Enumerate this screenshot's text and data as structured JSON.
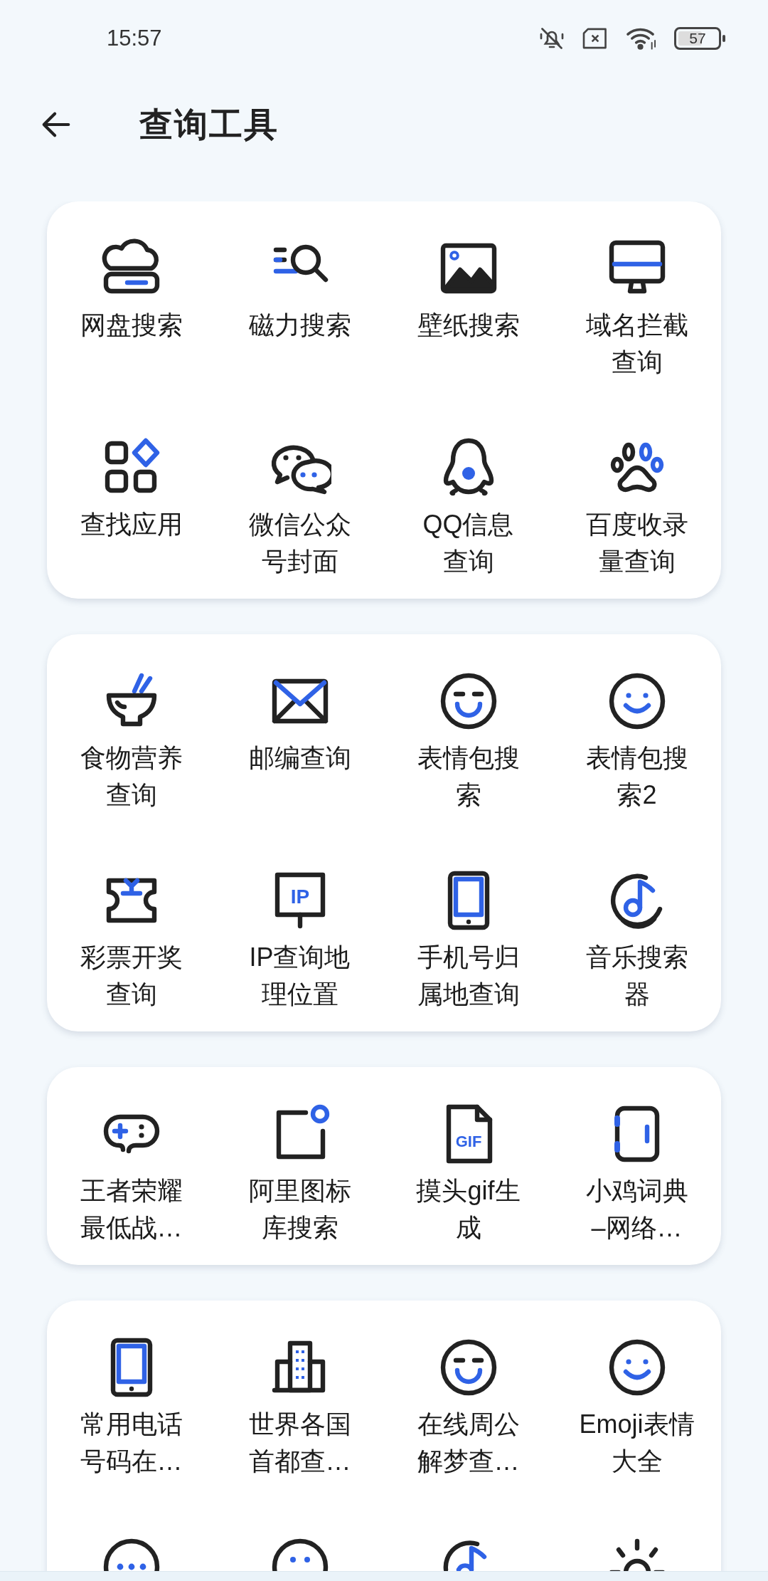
{
  "status_bar": {
    "time": "15:57",
    "battery": "57"
  },
  "header": {
    "title": "查询工具"
  },
  "cards": [
    {
      "items": [
        {
          "label": "网盘搜索"
        },
        {
          "label": "磁力搜索"
        },
        {
          "label": "壁纸搜索"
        },
        {
          "label": "域名拦截查询"
        },
        {
          "label": "查找应用"
        },
        {
          "label": "微信公众号封面"
        },
        {
          "label": "QQ信息查询"
        },
        {
          "label": "百度收录量查询"
        }
      ]
    },
    {
      "items": [
        {
          "label": "食物营养查询"
        },
        {
          "label": "邮编查询"
        },
        {
          "label": "表情包搜索"
        },
        {
          "label": "表情包搜索2"
        },
        {
          "label": "彩票开奖查询"
        },
        {
          "label": "IP查询地理位置",
          "icon_text": "IP"
        },
        {
          "label": "手机号归属地查询"
        },
        {
          "label": "音乐搜索器"
        }
      ]
    },
    {
      "items": [
        {
          "label": "王者荣耀最低战…"
        },
        {
          "label": "阿里图标库搜索"
        },
        {
          "label": "摸头gif生成",
          "icon_text": "GIF"
        },
        {
          "label": "小鸡词典–网络…"
        }
      ]
    },
    {
      "items": [
        {
          "kind": "labeled",
          "label": "常用电话号码在…"
        },
        {
          "kind": "labeled",
          "label": "世界各国首都查…"
        },
        {
          "kind": "labeled",
          "label": "在线周公解梦查…"
        },
        {
          "kind": "labeled",
          "label": "Emoji表情大全"
        },
        {
          "kind": "cut"
        },
        {
          "kind": "cut"
        },
        {
          "kind": "cut"
        },
        {
          "kind": "cut"
        }
      ]
    }
  ]
}
